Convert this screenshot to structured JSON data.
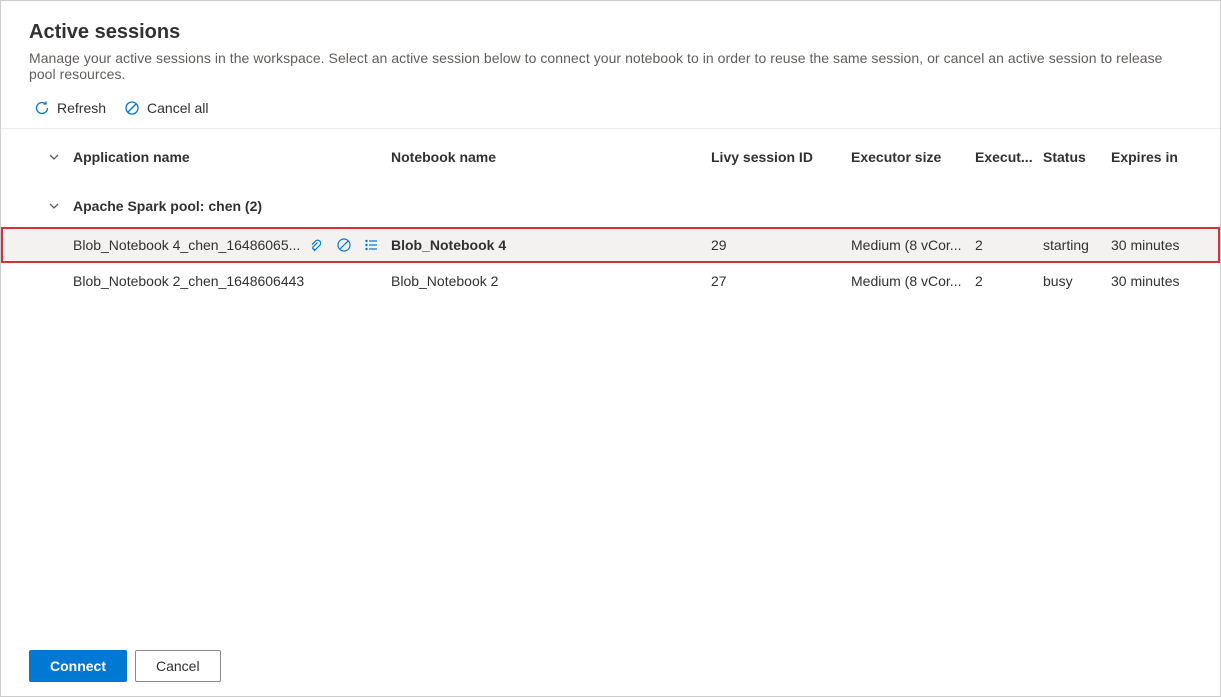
{
  "header": {
    "title": "Active sessions",
    "subtitle": "Manage your active sessions in the workspace. Select an active session below to connect your notebook to in order to reuse the same session, or cancel an active session to release pool resources."
  },
  "toolbar": {
    "refresh": "Refresh",
    "cancel_all": "Cancel all"
  },
  "columns": {
    "application_name": "Application name",
    "notebook_name": "Notebook name",
    "livy_session_id": "Livy session ID",
    "executor_size": "Executor size",
    "executors": "Execut...",
    "status": "Status",
    "expires_in": "Expires in"
  },
  "group": {
    "label": "Apache Spark pool: chen (2)"
  },
  "rows": [
    {
      "selected": true,
      "application_name": "Blob_Notebook 4_chen_16486065...",
      "notebook_name": "Blob_Notebook 4",
      "livy_session_id": "29",
      "executor_size": "Medium (8 vCor...",
      "executors": "2",
      "status": "starting",
      "expires_in": "30 minutes"
    },
    {
      "selected": false,
      "application_name": "Blob_Notebook 2_chen_1648606443",
      "notebook_name": "Blob_Notebook 2",
      "livy_session_id": "27",
      "executor_size": "Medium (8 vCor...",
      "executors": "2",
      "status": "busy",
      "expires_in": "30 minutes"
    }
  ],
  "footer": {
    "connect": "Connect",
    "cancel": "Cancel"
  }
}
